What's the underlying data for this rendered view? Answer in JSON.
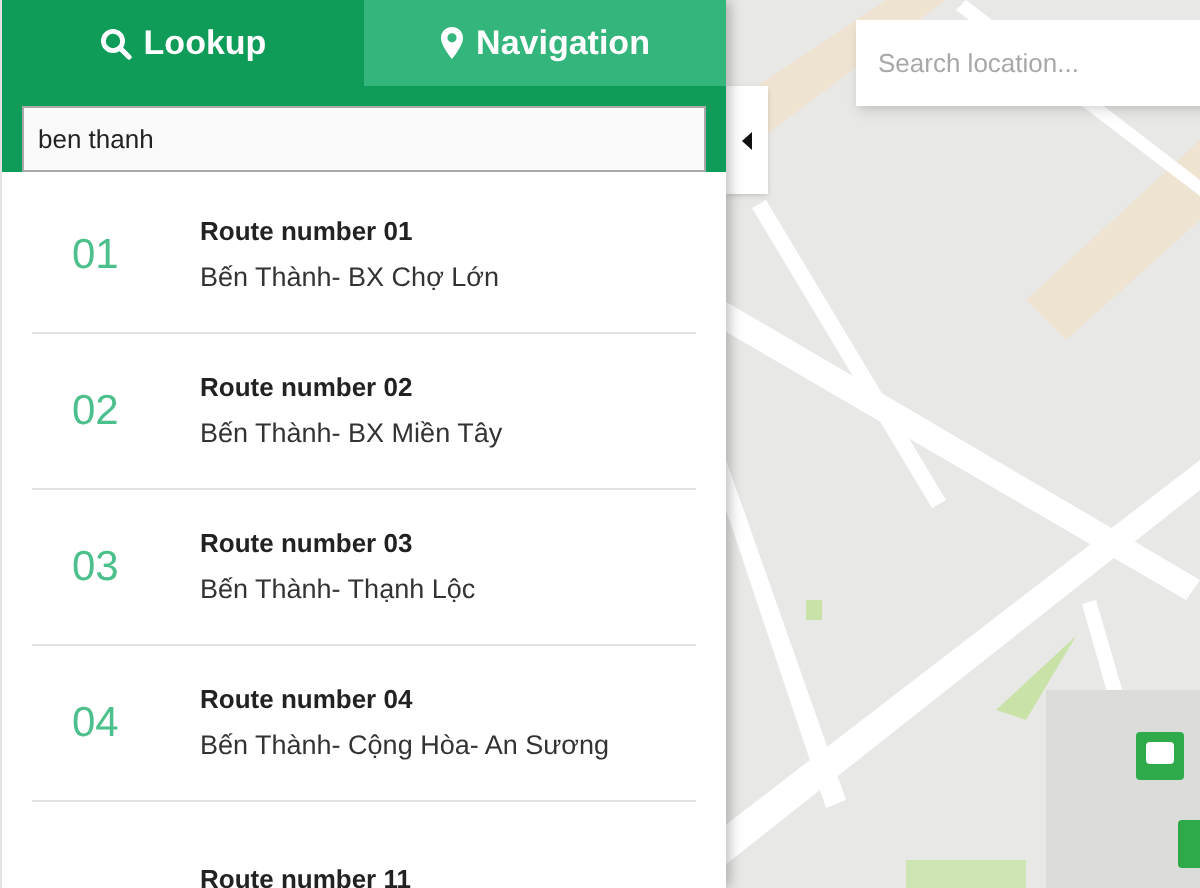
{
  "tabs": [
    {
      "label": "Lookup",
      "kind": "search",
      "selected": true
    },
    {
      "label": "Navigation",
      "kind": "pin",
      "selected": false
    }
  ],
  "lookup_search": {
    "value": "ben thanh"
  },
  "routes": [
    {
      "number": "01",
      "title": "Route number 01",
      "stops": "Bến Thành- BX Chợ Lớn"
    },
    {
      "number": "02",
      "title": "Route number 02",
      "stops": "Bến Thành- BX Miền Tây"
    },
    {
      "number": "03",
      "title": "Route number 03",
      "stops": "Bến Thành- Thạnh Lộc"
    },
    {
      "number": "04",
      "title": "Route number 04",
      "stops": "Bến Thành- Cộng Hòa- An Sương"
    },
    {
      "title": "Route number 11"
    }
  ],
  "map": {
    "kind": "picture",
    "search": {
      "placeholder": "Search location..."
    }
  }
}
